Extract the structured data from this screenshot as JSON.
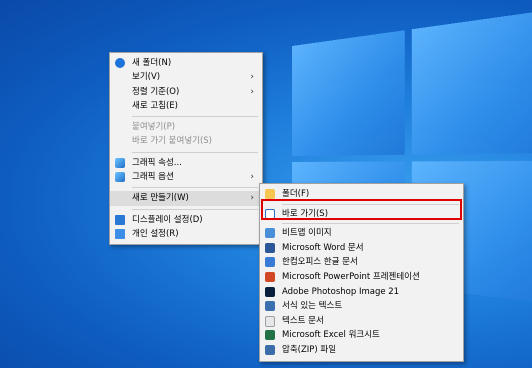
{
  "context_menu": {
    "items": [
      {
        "label": "새 폴더(N)",
        "icon": "new-folder-icon"
      },
      {
        "label": "보기(V)",
        "submenu": true
      },
      {
        "label": "정렬 기준(O)",
        "submenu": true
      },
      {
        "label": "새로 고침(E)"
      },
      {
        "label": "붙여넣기(P)",
        "disabled": true
      },
      {
        "label": "바로 가기 붙여넣기(S)",
        "disabled": true
      },
      {
        "label": "그래픽 속성...",
        "icon": "graphics-icon"
      },
      {
        "label": "그래픽 옵션",
        "icon": "graphics-icon",
        "submenu": true
      },
      {
        "label": "새로 만들기(W)",
        "submenu": true,
        "highlighted": true
      },
      {
        "label": "디스플레이 설정(D)",
        "icon": "display-icon"
      },
      {
        "label": "개인 설정(R)",
        "icon": "personalize-icon"
      }
    ]
  },
  "new_submenu": {
    "items": [
      {
        "label": "폴더(F)",
        "icon": "folder-icon",
        "color": "#f6c650"
      },
      {
        "label": "바로 가기(S)",
        "icon": "shortcut-icon",
        "color": "#2b6fc7",
        "highlighted": true
      },
      {
        "label": "비트맵 이미지",
        "icon": "bitmap-icon",
        "color": "#4a90d9"
      },
      {
        "label": "Microsoft Word 문서",
        "icon": "word-icon",
        "color": "#2b5797"
      },
      {
        "label": "한컴오피스 한글 문서",
        "icon": "hwp-icon",
        "color": "#3a7bd5"
      },
      {
        "label": "Microsoft PowerPoint 프레젠테이션",
        "icon": "powerpoint-icon",
        "color": "#d24726"
      },
      {
        "label": "Adobe Photoshop Image 21",
        "icon": "photoshop-icon",
        "color": "#0a1f3c"
      },
      {
        "label": "서식 있는 텍스트",
        "icon": "rtf-icon",
        "color": "#3a6fb0"
      },
      {
        "label": "텍스트 문서",
        "icon": "text-document-icon",
        "color": "#9aa0a6"
      },
      {
        "label": "Microsoft Excel 워크시트",
        "icon": "excel-icon",
        "color": "#217346"
      },
      {
        "label": "압축(ZIP) 파일",
        "icon": "zip-icon",
        "color": "#3b6ea8"
      }
    ]
  },
  "colors": {
    "accent_red": "#e00000",
    "desktop_blue": "#0e5cc0"
  }
}
